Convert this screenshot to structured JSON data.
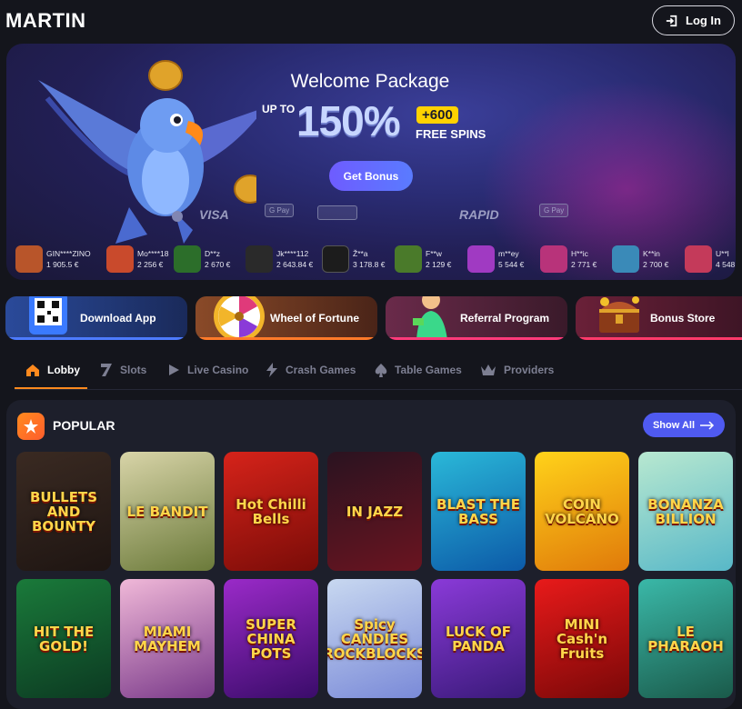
{
  "header": {
    "logo_text": "MARTIN",
    "login_label": "Log In"
  },
  "hero": {
    "title": "Welcome Package",
    "upto": "UP TO",
    "percent": "150%",
    "plus": "+600",
    "free_spins": "FREE SPINS",
    "cta": "Get Bonus",
    "payments": [
      "VISA",
      "G Pay",
      "RAPID",
      "G Pay"
    ]
  },
  "winners": [
    {
      "name": "GIN****ZINO",
      "amount": "1 905.5 €",
      "color": "#b8552a"
    },
    {
      "name": "Mo****18",
      "amount": "2 256 €",
      "color": "#c94a2c"
    },
    {
      "name": "D**z",
      "amount": "2 670 €",
      "color": "#2c6e2a"
    },
    {
      "name": "Jk****112",
      "amount": "2 643.84 €",
      "color": "#2a2a2a"
    },
    {
      "name": "Ž**a",
      "amount": "3 178.8 €",
      "color": "#1c1c1c"
    },
    {
      "name": "F**w",
      "amount": "2 129 €",
      "color": "#4a7a2a"
    },
    {
      "name": "m**ey",
      "amount": "5 544 €",
      "color": "#a03ac2"
    },
    {
      "name": "H**ic",
      "amount": "2 771 €",
      "color": "#b8337a"
    },
    {
      "name": "K**in",
      "amount": "2 700 €",
      "color": "#3a8ab8"
    },
    {
      "name": "U**l",
      "amount": "4 548",
      "color": "#c43a5a"
    }
  ],
  "promos": [
    {
      "label": "Download App",
      "bg": "#1f3a7a",
      "bar": "#4d7bff"
    },
    {
      "label": "Wheel of Fortune",
      "bg": "#7a3a26",
      "bar": "#ff7a2a"
    },
    {
      "label": "Referral Program",
      "bg": "#5a2540",
      "bar": "#ff3a7a"
    },
    {
      "label": "Bonus Store",
      "bg": "#5a2038",
      "bar": "#ff3a6a"
    }
  ],
  "tabs": [
    {
      "label": "Lobby",
      "icon": "home-icon"
    },
    {
      "label": "Slots",
      "icon": "seven-icon"
    },
    {
      "label": "Live Casino",
      "icon": "play-icon"
    },
    {
      "label": "Crash Games",
      "icon": "lightning-icon"
    },
    {
      "label": "Table Games",
      "icon": "spade-icon"
    },
    {
      "label": "Providers",
      "icon": "crown-icon"
    }
  ],
  "popular": {
    "title": "POPULAR",
    "show_all": "Show All"
  },
  "games": [
    {
      "title": "BULLETS AND BOUNTY",
      "bg": "linear-gradient(160deg,#3a2a22,#1e1512)"
    },
    {
      "title": "LE BANDIT",
      "bg": "linear-gradient(160deg,#d8d4a8,#6b7a3a)"
    },
    {
      "title": "Hot Chilli Bells",
      "bg": "linear-gradient(160deg,#d6231a,#7a0c08)"
    },
    {
      "title": "IN JAZZ",
      "bg": "linear-gradient(160deg,#2a1320,#6a1420)"
    },
    {
      "title": "BLAST THE BASS",
      "bg": "linear-gradient(160deg,#2ab8d8,#0c5aa8)"
    },
    {
      "title": "COIN VOLCANO",
      "bg": "linear-gradient(160deg,#ffd21a,#e07a0a)"
    },
    {
      "title": "BONANZA BILLION",
      "bg": "linear-gradient(160deg,#b8e8d0,#58b8c8)"
    },
    {
      "title": "HIT THE GOLD!",
      "bg": "linear-gradient(160deg,#1a7a3a,#0c3a22)"
    },
    {
      "title": "MIAMI MAYHEM",
      "bg": "linear-gradient(160deg,#f0b8d8,#7a3a8a)"
    },
    {
      "title": "SUPER CHINA POTS",
      "bg": "linear-gradient(160deg,#9a2ac8,#3a0c6a)"
    },
    {
      "title": "Spicy CANDIES ROCKBLOCKS",
      "bg": "linear-gradient(160deg,#c8d8f0,#7a8ad8)"
    },
    {
      "title": "LUCK OF PANDA",
      "bg": "linear-gradient(160deg,#8a3ad8,#3a1a7a)"
    },
    {
      "title": "MINI Cash'n Fruits",
      "bg": "linear-gradient(160deg,#e81a1a,#7a0808)"
    },
    {
      "title": "LE PHARAOH",
      "bg": "linear-gradient(160deg,#3ab8a8,#1a5a4a)"
    }
  ]
}
